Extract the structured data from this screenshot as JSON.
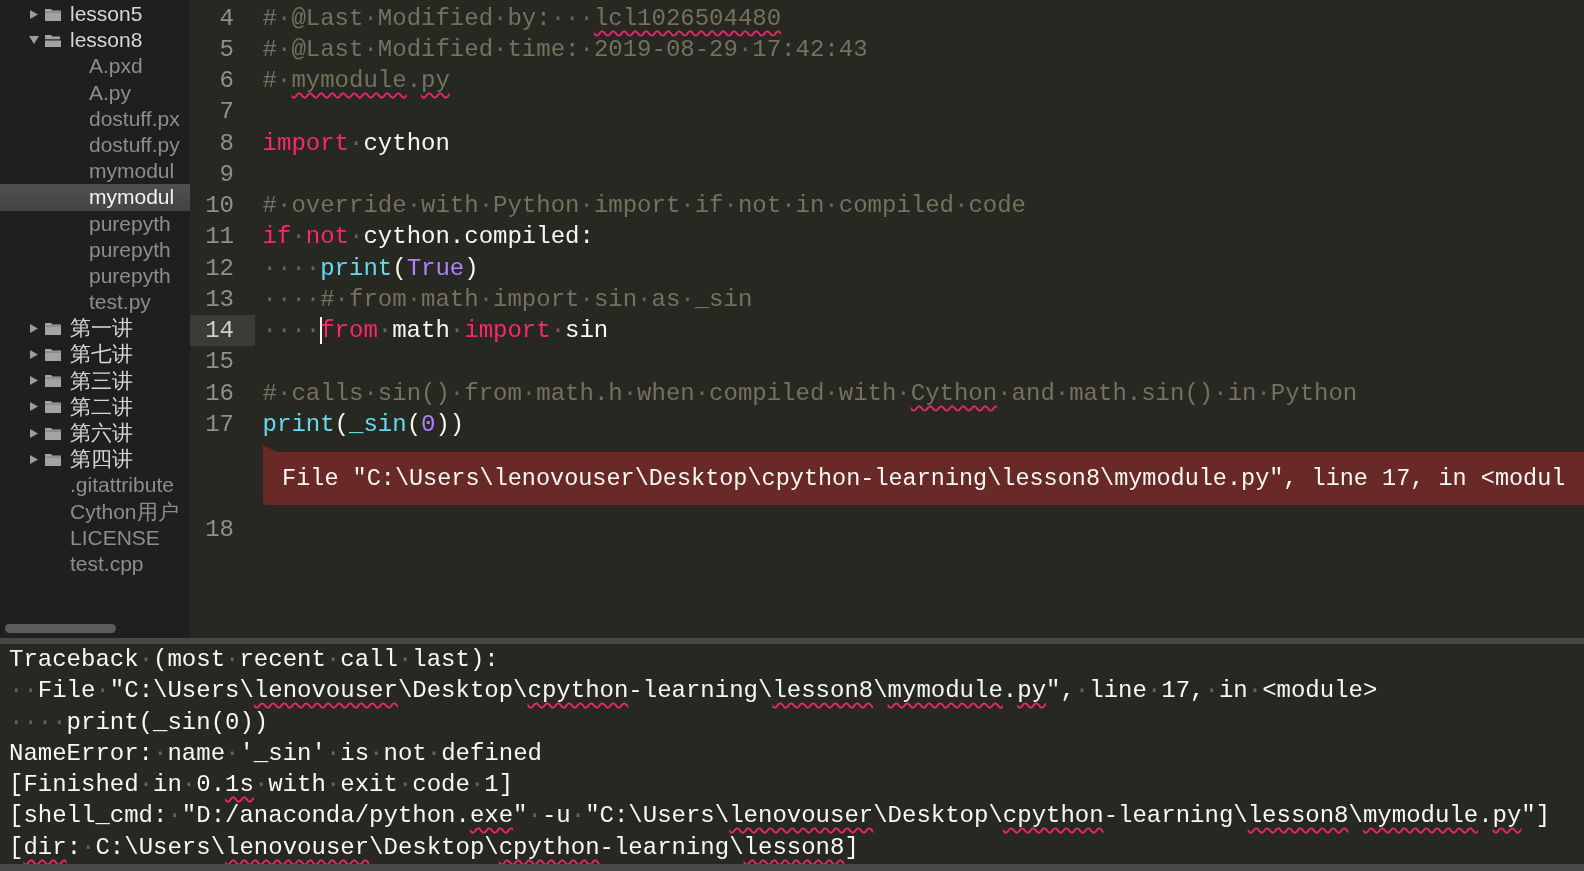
{
  "sidebar": {
    "items": [
      {
        "label": "lesson5",
        "kind": "folder",
        "expanded": false
      },
      {
        "label": "lesson8",
        "kind": "folder",
        "expanded": true,
        "children": [
          {
            "label": "A.pxd",
            "kind": "file",
            "selected": false
          },
          {
            "label": "A.py",
            "kind": "file",
            "selected": false
          },
          {
            "label": "dostuff.px",
            "kind": "file",
            "selected": false
          },
          {
            "label": "dostuff.py",
            "kind": "file",
            "selected": false
          },
          {
            "label": "mymodul",
            "kind": "file",
            "selected": false
          },
          {
            "label": "mymodul",
            "kind": "file",
            "selected": true
          },
          {
            "label": "purepyth",
            "kind": "file",
            "selected": false
          },
          {
            "label": "purepyth",
            "kind": "file",
            "selected": false
          },
          {
            "label": "purepyth",
            "kind": "file",
            "selected": false
          },
          {
            "label": "test.py",
            "kind": "file",
            "selected": false
          }
        ]
      },
      {
        "label": "第一讲",
        "kind": "folder",
        "expanded": false
      },
      {
        "label": "第七讲",
        "kind": "folder",
        "expanded": false
      },
      {
        "label": "第三讲",
        "kind": "folder",
        "expanded": false
      },
      {
        "label": "第二讲",
        "kind": "folder",
        "expanded": false
      },
      {
        "label": "第六讲",
        "kind": "folder",
        "expanded": false
      },
      {
        "label": "第四讲",
        "kind": "folder",
        "expanded": false
      },
      {
        "label": ".gitattribute",
        "kind": "file",
        "selected": false
      },
      {
        "label": "Cython用户",
        "kind": "file",
        "selected": false
      },
      {
        "label": "LICENSE",
        "kind": "file",
        "selected": false
      },
      {
        "label": "test.cpp",
        "kind": "file",
        "selected": false
      }
    ]
  },
  "editor": {
    "lines": [
      {
        "kind": "code",
        "number": "4",
        "current": false,
        "tokens": [
          {
            "kind": "comment",
            "text": "#·@Last·Modified·by:···",
            "misspelled": false
          },
          {
            "kind": "comment",
            "text": "lcl1026504480",
            "misspelled": true
          }
        ]
      },
      {
        "kind": "code",
        "number": "5",
        "current": false,
        "tokens": [
          {
            "kind": "comment",
            "text": "#·@Last·Modified·time:·2019-08-29·17:42:43",
            "misspelled": false
          }
        ]
      },
      {
        "kind": "code",
        "number": "6",
        "current": false,
        "tokens": [
          {
            "kind": "comment",
            "text": "#·",
            "misspelled": false
          },
          {
            "kind": "comment",
            "text": "mymodule",
            "misspelled": true
          },
          {
            "kind": "comment",
            "text": ".",
            "misspelled": false
          },
          {
            "kind": "comment",
            "text": "py",
            "misspelled": true
          }
        ]
      },
      {
        "kind": "code",
        "number": "7",
        "current": false
      },
      {
        "kind": "code",
        "number": "8",
        "current": false,
        "tokens": [
          {
            "kind": "keyword",
            "text": "import",
            "misspelled": false
          },
          {
            "kind": "plain",
            "text": "·cython",
            "misspelled": false
          }
        ]
      },
      {
        "kind": "code",
        "number": "9",
        "current": false
      },
      {
        "kind": "code",
        "number": "10",
        "current": false,
        "tokens": [
          {
            "kind": "comment",
            "text": "#·override·with·Python·import·if·not·in·compiled·code",
            "misspelled": false
          }
        ]
      },
      {
        "kind": "code",
        "number": "11",
        "current": false,
        "tokens": [
          {
            "kind": "keyword",
            "text": "if",
            "misspelled": false
          },
          {
            "kind": "plain",
            "text": "·",
            "misspelled": false
          },
          {
            "kind": "keyword",
            "text": "not",
            "misspelled": false
          },
          {
            "kind": "plain",
            "text": "·cython.compiled:",
            "misspelled": false
          }
        ]
      },
      {
        "kind": "code",
        "number": "12",
        "current": false,
        "tokens": [
          {
            "kind": "plain",
            "text": "····",
            "misspelled": false
          },
          {
            "kind": "function",
            "text": "print",
            "misspelled": false
          },
          {
            "kind": "plain",
            "text": "(",
            "misspelled": false
          },
          {
            "kind": "constant",
            "text": "True",
            "misspelled": false
          },
          {
            "kind": "plain",
            "text": ")",
            "misspelled": false
          }
        ]
      },
      {
        "kind": "code",
        "number": "13",
        "current": false,
        "tokens": [
          {
            "kind": "plain",
            "text": "····",
            "misspelled": false
          },
          {
            "kind": "comment",
            "text": "#·from·math·import·sin·as·_sin",
            "misspelled": false
          }
        ]
      },
      {
        "kind": "code",
        "number": "14",
        "current": true,
        "tokens": [
          {
            "kind": "plain",
            "text": "····",
            "misspelled": false
          },
          {
            "kind": "caret"
          },
          {
            "kind": "keyword",
            "text": "from",
            "misspelled": false
          },
          {
            "kind": "plain",
            "text": "·math·",
            "misspelled": false
          },
          {
            "kind": "keyword",
            "text": "import",
            "misspelled": false
          },
          {
            "kind": "plain",
            "text": "·sin",
            "misspelled": false
          }
        ]
      },
      {
        "kind": "code",
        "number": "15",
        "current": false
      },
      {
        "kind": "code",
        "number": "16",
        "current": false,
        "tokens": [
          {
            "kind": "comment",
            "text": "#·calls·sin()·from·math.h·when·compiled·with·",
            "misspelled": false
          },
          {
            "kind": "comment",
            "text": "Cython",
            "misspelled": true
          },
          {
            "kind": "comment",
            "text": "·and·math.sin()·in·Python",
            "misspelled": false
          }
        ]
      },
      {
        "kind": "code",
        "number": "17",
        "current": false,
        "tokens": [
          {
            "kind": "function",
            "text": "print",
            "misspelled": false
          },
          {
            "kind": "plain",
            "text": "(",
            "misspelled": false
          },
          {
            "kind": "function",
            "text": "_sin",
            "misspelled": false
          },
          {
            "kind": "plain",
            "text": "(",
            "misspelled": false
          },
          {
            "kind": "constant",
            "text": "0",
            "misspelled": false
          },
          {
            "kind": "plain",
            "text": "))",
            "misspelled": false
          }
        ]
      },
      {
        "kind": "phantom",
        "text": "File \"C:\\Users\\lenovouser\\Desktop\\cpython-learning\\lesson8\\mymodule.py\", line 17, in <modul"
      },
      {
        "kind": "code",
        "number": "18",
        "current": false
      }
    ]
  },
  "console": {
    "lines": [
      {
        "tokens": [
          {
            "text": "Traceback·(most·recent·call·last):",
            "misspelled": false
          }
        ]
      },
      {
        "tokens": [
          {
            "text": "··File·\"C:\\Users\\",
            "misspelled": false
          },
          {
            "text": "lenovouser",
            "misspelled": true
          },
          {
            "text": "\\Desktop\\",
            "misspelled": false
          },
          {
            "text": "cpython",
            "misspelled": true
          },
          {
            "text": "-learning\\",
            "misspelled": false
          },
          {
            "text": "lesson8",
            "misspelled": true
          },
          {
            "text": "\\",
            "misspelled": false
          },
          {
            "text": "mymodule",
            "misspelled": true
          },
          {
            "text": ".",
            "misspelled": false
          },
          {
            "text": "py",
            "misspelled": true
          },
          {
            "text": "\",·line·17,·in·<module>",
            "misspelled": false
          }
        ]
      },
      {
        "tokens": [
          {
            "text": "····print(_sin(0))",
            "misspelled": false
          }
        ]
      },
      {
        "tokens": [
          {
            "text": "NameError:·name·'_sin'·is·not·defined",
            "misspelled": false
          }
        ]
      },
      {
        "tokens": [
          {
            "text": "[Finished·in·0.",
            "misspelled": false
          },
          {
            "text": "1s",
            "misspelled": true
          },
          {
            "text": "·with·exit·code·1]",
            "misspelled": false
          }
        ]
      },
      {
        "tokens": [
          {
            "text": "[shell_cmd:·\"D:/anaconda/python.",
            "misspelled": false
          },
          {
            "text": "exe",
            "misspelled": true
          },
          {
            "text": "\"·-u·\"C:\\Users\\",
            "misspelled": false
          },
          {
            "text": "lenovouser",
            "misspelled": true
          },
          {
            "text": "\\Desktop\\",
            "misspelled": false
          },
          {
            "text": "cpython",
            "misspelled": true
          },
          {
            "text": "-learning\\",
            "misspelled": false
          },
          {
            "text": "lesson8",
            "misspelled": true
          },
          {
            "text": "\\",
            "misspelled": false
          },
          {
            "text": "mymodule",
            "misspelled": true
          },
          {
            "text": ".",
            "misspelled": false
          },
          {
            "text": "py",
            "misspelled": true
          },
          {
            "text": "\"]",
            "misspelled": false
          }
        ]
      },
      {
        "tokens": [
          {
            "text": "[",
            "misspelled": false
          },
          {
            "text": "dir",
            "misspelled": true
          },
          {
            "text": ":·C:\\Users\\",
            "misspelled": false
          },
          {
            "text": "lenovouser",
            "misspelled": true
          },
          {
            "text": "\\Desktop\\",
            "misspelled": false
          },
          {
            "text": "cpython",
            "misspelled": true
          },
          {
            "text": "-learning\\",
            "misspelled": false
          },
          {
            "text": "lesson8",
            "misspelled": true
          },
          {
            "text": "]",
            "misspelled": false
          }
        ]
      }
    ]
  }
}
